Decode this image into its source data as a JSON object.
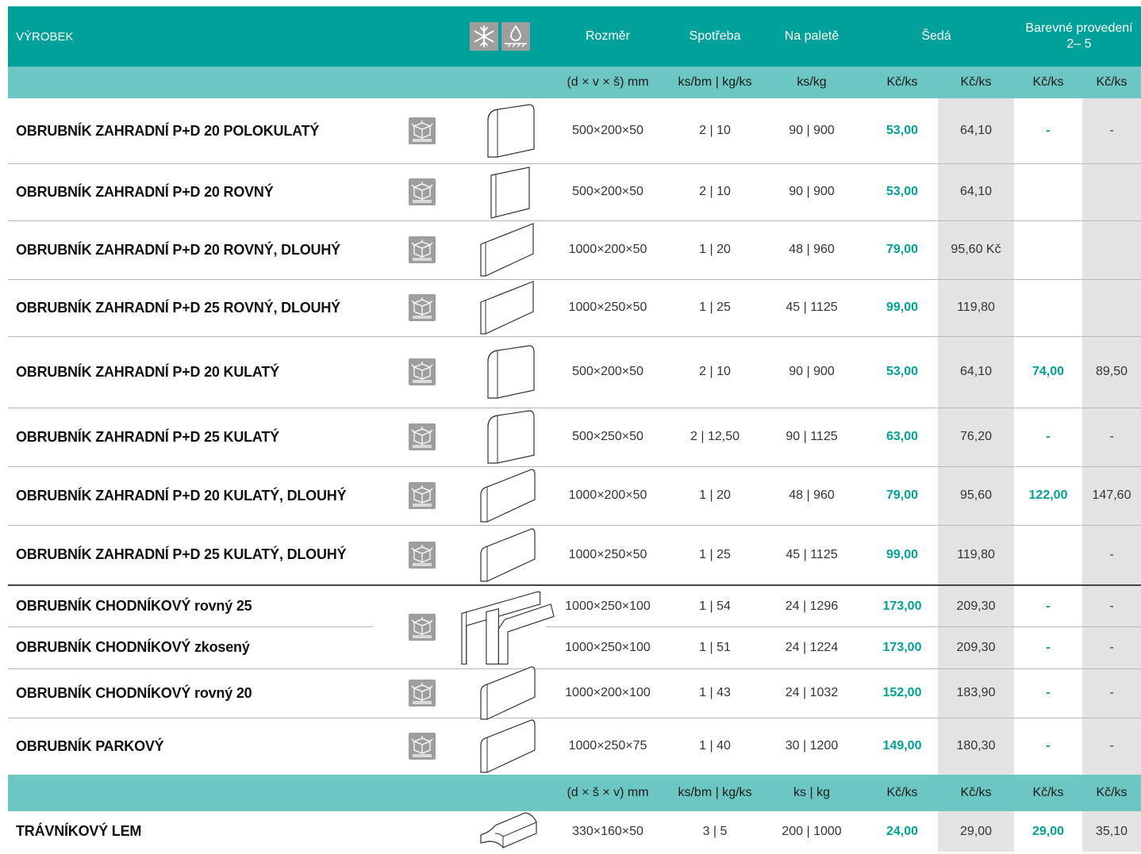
{
  "header": {
    "vyrobek": "VÝROBEK",
    "rozmer": "Rozměr",
    "spotreba": "Spotřeba",
    "na_palete": "Na paletě",
    "seda": "Šedá",
    "barevne_line1": "Barevné provedení",
    "barevne_line2": "2– 5",
    "icons": [
      "frost-resistant-icon",
      "water-resistant-icon"
    ]
  },
  "subheader1": {
    "rozmer": "(d × v × š) mm",
    "spotreba": "ks/bm | kg/ks",
    "na_palete": "ks/kg",
    "c1": "Kč/ks",
    "c2": "Kč/ks",
    "c3": "Kč/ks",
    "c4": "Kč/ks"
  },
  "subheader2": {
    "rozmer": "(d × š × v) mm",
    "spotreba": "ks/bm | kg/ks",
    "na_palete": "ks | kg",
    "c1": "Kč/ks",
    "c2": "Kč/ks",
    "c3": "Kč/ks",
    "c4": "Kč/ks"
  },
  "rows": [
    {
      "name": "OBRUBNÍK ZAHRADNÍ P+D 20 POLOKULATÝ",
      "rozmer": "500×200×50",
      "spotreba": "2 | 10",
      "paleta": "90 | 900",
      "c1": "53,00",
      "c2": "64,10",
      "c3": "-",
      "c4": "-",
      "shape": "rounded-short"
    },
    {
      "name": "OBRUBNÍK ZAHRADNÍ P+D 20 ROVNÝ",
      "rozmer": "500×200×50",
      "spotreba": "2 | 10",
      "paleta": "90 | 900",
      "c1": "53,00",
      "c2": "64,10",
      "c3": "",
      "c4": "",
      "shape": "flat-short"
    },
    {
      "name": "OBRUBNÍK ZAHRADNÍ P+D 20 ROVNÝ, DLOUHÝ",
      "rozmer": "1000×200×50",
      "spotreba": "1 | 20",
      "paleta": "48 | 960",
      "c1": "79,00",
      "c2": "95,60 Kč",
      "c3": "",
      "c4": "",
      "shape": "flat-long"
    },
    {
      "name": "OBRUBNÍK ZAHRADNÍ P+D 25 ROVNÝ, DLOUHÝ",
      "rozmer": "1000×250×50",
      "spotreba": "1 | 25",
      "paleta": "45 | 1125",
      "c1": "99,00",
      "c2": "119,80",
      "c3": "",
      "c4": "",
      "shape": "flat-long"
    },
    {
      "name": "OBRUBNÍK ZAHRADNÍ P+D 20 KULATÝ",
      "rozmer": "500×200×50",
      "spotreba": "2 | 10",
      "paleta": "90 | 900",
      "c1": "53,00",
      "c2": "64,10",
      "c3": "74,00",
      "c4": "89,50",
      "shape": "rounded-short"
    },
    {
      "name": "OBRUBNÍK ZAHRADNÍ P+D 25 KULATÝ",
      "rozmer": "500×250×50",
      "spotreba": "2 | 12,50",
      "paleta": "90 | 1125",
      "c1": "63,00",
      "c2": "76,20",
      "c3": "-",
      "c4": "-",
      "shape": "rounded-short"
    },
    {
      "name": "OBRUBNÍK ZAHRADNÍ P+D 20 KULATÝ, DLOUHÝ",
      "rozmer": "1000×200×50",
      "spotreba": "1 | 20",
      "paleta": "48 | 960",
      "c1": "79,00",
      "c2": "95,60",
      "c3": "122,00",
      "c4": "147,60",
      "shape": "rounded-long"
    },
    {
      "name": "OBRUBNÍK ZAHRADNÍ P+D 25 KULATÝ, DLOUHÝ",
      "rozmer": "1000×250×50",
      "spotreba": "1 | 25",
      "paleta": "45 | 1125",
      "c1": "99,00",
      "c2": "119,80",
      "c3": "",
      "c4": "-",
      "shape": "rounded-long"
    },
    {
      "name": "OBRUBNÍK CHODNÍKOVÝ rovný 25",
      "rozmer": "1000×250×100",
      "spotreba": "1 | 54",
      "paleta": "24 | 1296",
      "c1": "173,00",
      "c2": "209,30",
      "c3": "-",
      "c4": "-",
      "shape": "pair"
    },
    {
      "name": "OBRUBNÍK CHODNÍKOVÝ zkosený",
      "rozmer": "1000×250×100",
      "spotreba": "1 | 51",
      "paleta": "24 | 1224",
      "c1": "173,00",
      "c2": "209,30",
      "c3": "-",
      "c4": "-",
      "shape": "none"
    },
    {
      "name": "OBRUBNÍK CHODNÍKOVÝ rovný 20",
      "rozmer": "1000×200×100",
      "spotreba": "1 | 43",
      "paleta": "24 | 1032",
      "c1": "152,00",
      "c2": "183,90",
      "c3": "-",
      "c4": "-",
      "shape": "rounded-long"
    },
    {
      "name": "OBRUBNÍK PARKOVÝ",
      "rozmer": "1000×250×75",
      "spotreba": "1 | 40",
      "paleta": "30 | 1200",
      "c1": "149,00",
      "c2": "180,30",
      "c3": "-",
      "c4": "-",
      "shape": "rounded-long"
    },
    {
      "name": "TRÁVNÍKOVÝ LEM",
      "rozmer": "330×160×50",
      "spotreba": "3 | 5",
      "paleta": "200 | 1000",
      "c1": "24,00",
      "c2": "29,00",
      "c3": "29,00",
      "c4": "35,10",
      "shape": "lem"
    }
  ],
  "colors": {
    "teal": "#00a19a",
    "light_teal": "#6cc6c2",
    "grey_column": "#e3e3e3",
    "pallet_icon": "#9e9e9e"
  }
}
